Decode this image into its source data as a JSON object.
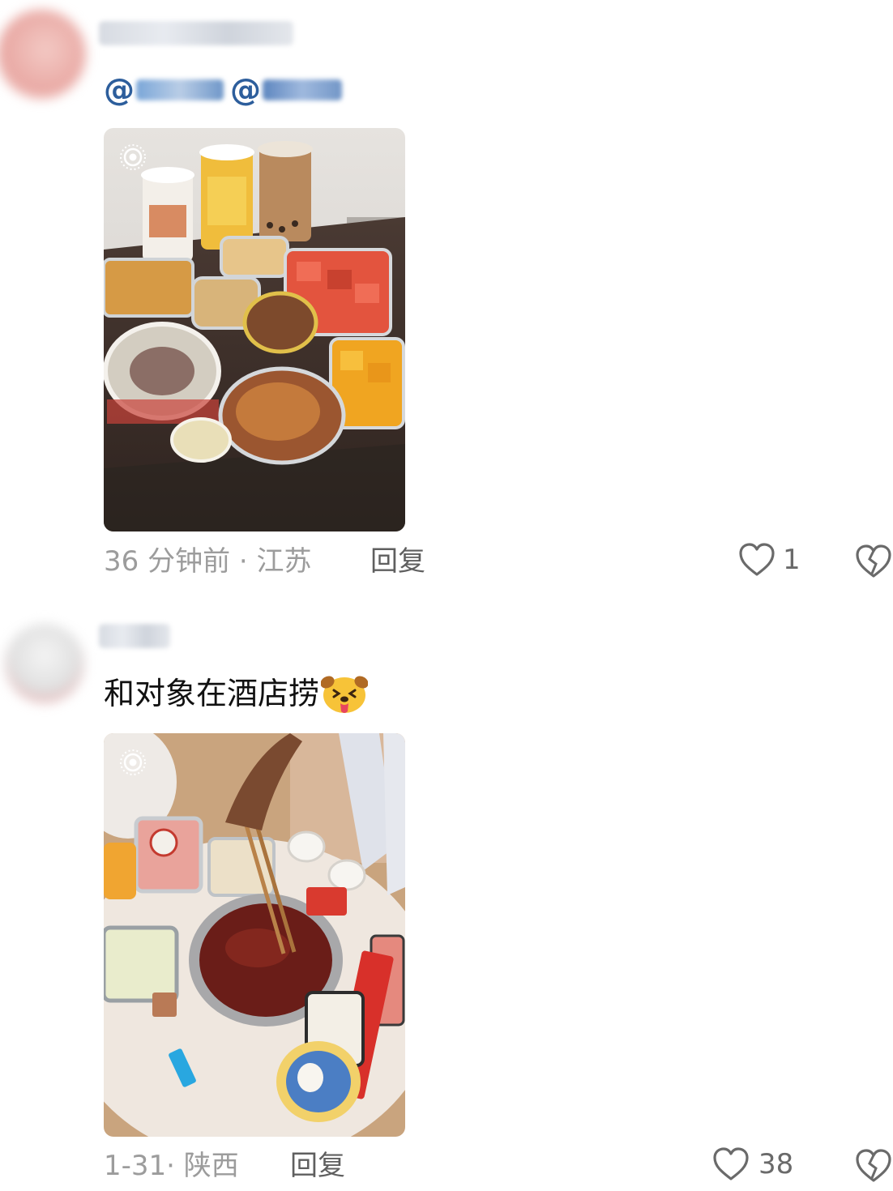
{
  "comments": [
    {
      "mention_symbols": [
        "@",
        "@"
      ],
      "time_location": "36 分钟前 · 江苏",
      "reply_label": "回复",
      "like_count": "1",
      "icons": {
        "like": "heart-outline-icon",
        "dislike": "broken-heart-icon",
        "live": "live-photo-icon"
      }
    },
    {
      "text": "和对象在酒店捞",
      "emoji": "dog-face-tongue-emoji",
      "time_location": "1-31· 陕西",
      "reply_label": "回复",
      "like_count": "38",
      "icons": {
        "like": "heart-outline-icon",
        "dislike": "broken-heart-icon",
        "live": "live-photo-icon"
      }
    }
  ],
  "colors": {
    "mention": "#2d5e9c",
    "meta": "#9c9c9c",
    "reply": "#5f5f5f",
    "text": "#111111"
  }
}
